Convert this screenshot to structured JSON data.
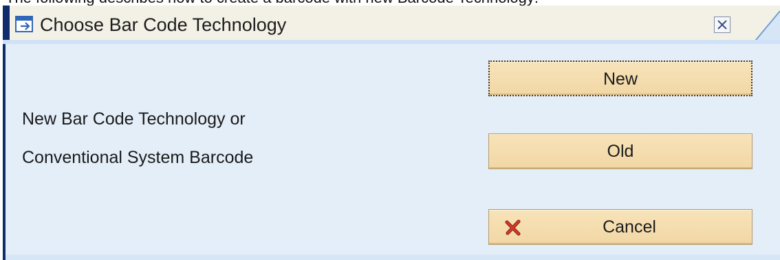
{
  "page": {
    "caption": "The following describes how to create a barcode with new Barcode Technology:"
  },
  "dialog": {
    "title": "Choose Bar Code Technology",
    "message_line1": "New Bar Code Technology or",
    "message_line2": "Conventional System Barcode",
    "buttons": {
      "new": "New",
      "old": "Old",
      "cancel": "Cancel"
    },
    "icons": {
      "title": "dialog-window-icon",
      "close": "close-icon",
      "cancel": "red-x-icon"
    },
    "colors": {
      "title_accent": "#0f2a6d",
      "body_background": "#e4eef9",
      "button_background": "#f2d7a5",
      "cancel_icon": "#d23a2a"
    }
  }
}
